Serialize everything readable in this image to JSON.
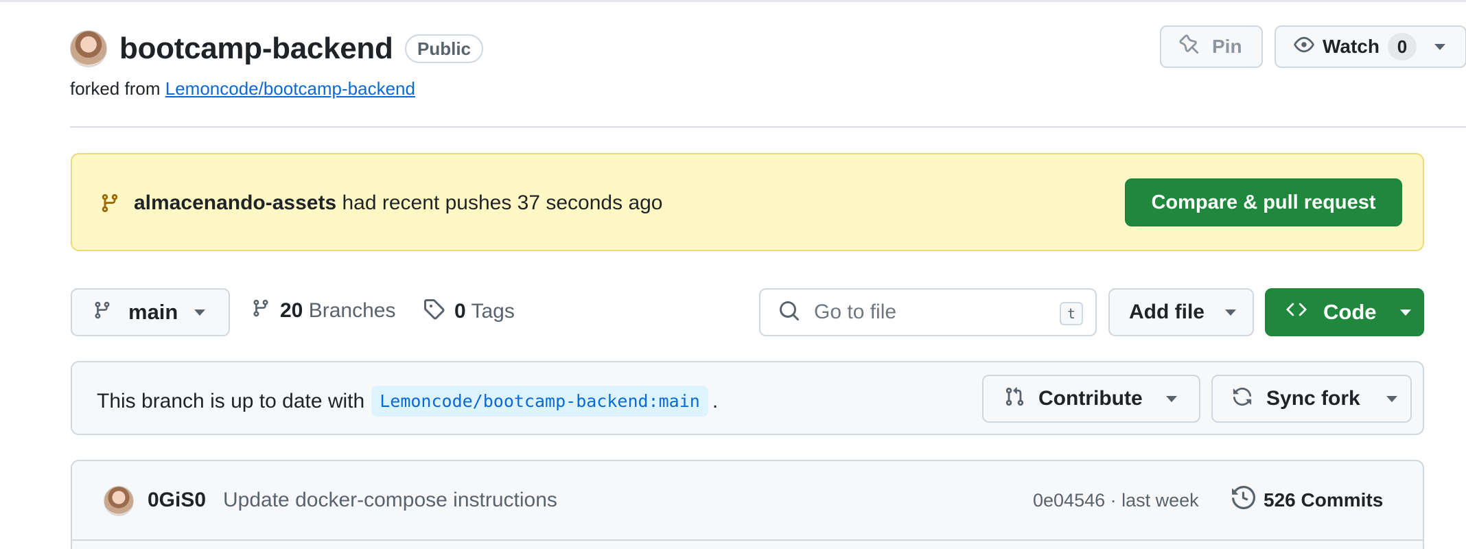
{
  "repo": {
    "name": "bootcamp-backend",
    "visibility": "Public",
    "forked_prefix": "forked from",
    "forked_from": "Lemoncode/bootcamp-backend"
  },
  "header_actions": {
    "pin_label": "Pin",
    "watch_label": "Watch",
    "watch_count": "0"
  },
  "banner": {
    "branch": "almacenando-assets",
    "message": "had recent pushes 37 seconds ago",
    "button": "Compare & pull request"
  },
  "toolbar": {
    "branch": "main",
    "branches_count": "20",
    "branches_label": "Branches",
    "tags_count": "0",
    "tags_label": "Tags",
    "search_placeholder": "Go to file",
    "search_shortcut": "t",
    "add_file": "Add file",
    "code": "Code"
  },
  "status": {
    "text": "This branch is up to date with",
    "ref": "Lemoncode/bootcamp-backend:main",
    "suffix": ".",
    "contribute": "Contribute",
    "sync_fork": "Sync fork"
  },
  "latest_commit": {
    "author": "0GiS0",
    "message": "Update docker-compose instructions",
    "meta": "0e04546 · last week",
    "commits": "526 Commits"
  },
  "colors": {
    "accent_green": "#1f883d",
    "link_blue": "#0969da",
    "banner_yellow": "#fff8c5"
  }
}
